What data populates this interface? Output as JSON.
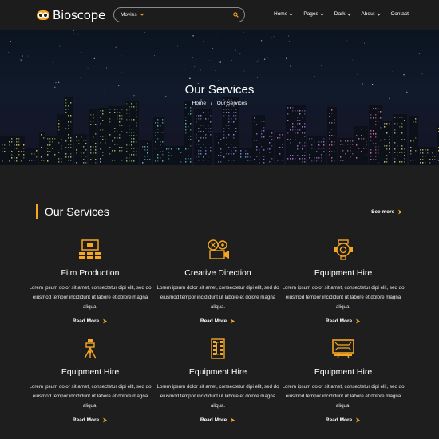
{
  "brand": {
    "name": "Bioscope",
    "accent": "#f5a623"
  },
  "header": {
    "search": {
      "category": "Movies",
      "placeholder": ""
    },
    "nav": [
      {
        "label": "Home",
        "dropdown": true
      },
      {
        "label": "Pages",
        "dropdown": true
      },
      {
        "label": "Dark",
        "dropdown": true
      },
      {
        "label": "About",
        "dropdown": true
      },
      {
        "label": "Contact",
        "dropdown": false
      }
    ]
  },
  "hero": {
    "title": "Our Services",
    "breadcrumb": {
      "home": "Home",
      "separator": "/",
      "current": "Our Services"
    }
  },
  "services": {
    "title": "Our Services",
    "see_more": "See more",
    "cards": [
      {
        "icon": "film-production-icon",
        "title": "Film Production",
        "desc": "Lorem ipsum dolor sit amet, consectetur dipi elit, sed do eiusmod tempor incididunt ut labore et dolore magna aliqua.",
        "link": "Read More"
      },
      {
        "icon": "film-reel-camera-icon",
        "title": "Creative Direction",
        "desc": "Lorem ipsum dolor sit amet, consectetur dipi elit, sed do eiusmod tempor incididunt ut labore et dolore magna aliqua.",
        "link": "Read More"
      },
      {
        "icon": "camera-lens-icon",
        "title": "Equipment Hire",
        "desc": "Lorem ipsum dolor sit amet, consectetur dipi elit, sed do eiusmod tempor incididunt ut labore et dolore magna aliqua.",
        "link": "Read More"
      },
      {
        "icon": "tripod-icon",
        "title": "Equipment Hire",
        "desc": "Lorem ipsum dolor sit amet, consectetur dipi elit, sed do eiusmod tempor incididunt ut labore et dolore magna aliqua.",
        "link": "Read More"
      },
      {
        "icon": "film-strip-icon",
        "title": "Equipment Hire",
        "desc": "Lorem ipsum dolor sit amet, consectetur dipi elit, sed do eiusmod tempor incididunt ut labore et dolore magna aliqua.",
        "link": "Read More"
      },
      {
        "icon": "screen-icon",
        "title": "Equipment Hire",
        "desc": "Lorem ipsum dolor sit amet, consectetur dipi elit, sed do eiusmod tempor incididunt ut labore et dolore magna aliqua.",
        "link": "Read More"
      }
    ]
  }
}
